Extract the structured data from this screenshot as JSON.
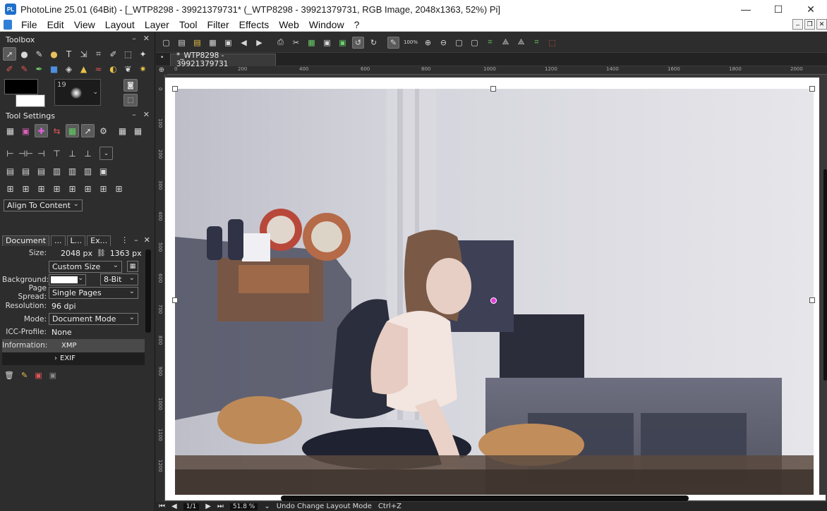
{
  "window": {
    "title": "PhotoLine 25.01 (64Bit) - [_WTP8298 - 39921379731* (_WTP8298 - 39921379731, RGB Image, 2048x1363, 52%) Pi]",
    "app_icon_label": "PL",
    "minimize": "—",
    "maximize": "☐",
    "close": "✕"
  },
  "menu": {
    "items": [
      "File",
      "Edit",
      "View",
      "Layout",
      "Layer",
      "Tool",
      "Filter",
      "Effects",
      "Web",
      "Window",
      "?"
    ]
  },
  "toolbox": {
    "title": "Toolbox",
    "brush_size": "19"
  },
  "tool_settings": {
    "title": "Tool Settings",
    "align_dropdown": "Align To Content"
  },
  "document_panel": {
    "tabs": [
      "Document",
      "...",
      "L...",
      "Ex..."
    ],
    "size_label": "Size:",
    "width": "2048 px",
    "height": "1363 px",
    "size_preset": "Custom Size",
    "background_label": "Background:",
    "bit_depth": "8-Bit",
    "page_spread_label": "Page Spread:",
    "page_spread": "Single Pages",
    "resolution_label": "Resolution:",
    "resolution": "96 dpi",
    "mode_label": "Mode:",
    "mode": "Document Mode",
    "icc_label": "ICC-Profile:",
    "icc": "None",
    "information_label": "Information:",
    "xmp": "XMP",
    "exif": "EXIF"
  },
  "canvas": {
    "doc_tab": "*_WTP8298 - 39921379731",
    "zoom_toolbar": "100%",
    "ruler_labels": [
      "0",
      "200",
      "400",
      "600",
      "800",
      "1000",
      "1200",
      "1400",
      "1600",
      "1800",
      "2000"
    ],
    "vruler_labels": [
      "0",
      "100",
      "200",
      "300",
      "400",
      "500",
      "600",
      "700",
      "800",
      "900",
      "1000",
      "1100",
      "1200"
    ]
  },
  "status": {
    "page": "1/1",
    "zoom": "51.8 %",
    "message": "Undo Change Layout Mode",
    "shortcut": "Ctrl+Z"
  }
}
